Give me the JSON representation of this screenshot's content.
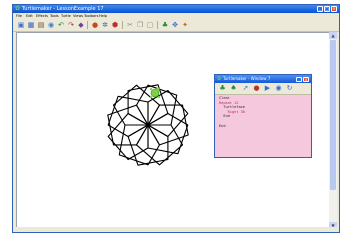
{
  "window": {
    "title": "Turtlemaker - LessonExample 17",
    "menu": [
      "File",
      "Edit",
      "Effects",
      "Tools",
      "Turtle",
      "Views",
      "Toolbars",
      "Help"
    ]
  },
  "toolbar": {
    "icons": [
      "new-icon",
      "save-icon",
      "print-icon",
      "open-icon",
      "undo-icon",
      "redo-icon",
      "color-icon",
      "circle-icon",
      "stop-icon",
      "cut-icon",
      "copy-icon",
      "paste-icon",
      "turtle-icon",
      "move-icon",
      "settings-icon"
    ]
  },
  "code_panel": {
    "title": "Turtlemaker - Window 7",
    "lines": [
      "Clear",
      "Repeat 12",
      "  Turtleface",
      "    Right 30",
      "  End",
      "  ",
      "End"
    ]
  },
  "colors": {
    "titlebar": "#0a4fd0",
    "panel_bg": "#f6c8de",
    "turtle": "#7bd14b",
    "drawing": "#000000"
  }
}
